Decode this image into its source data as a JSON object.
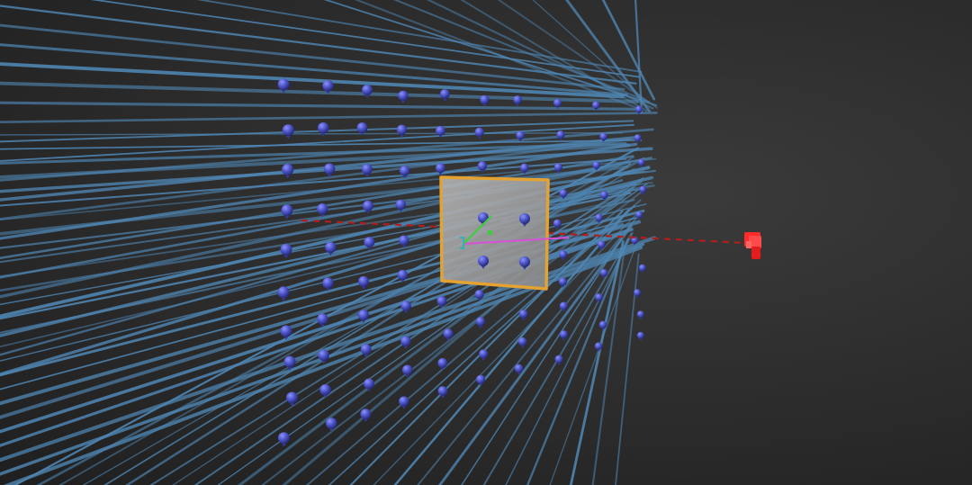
{
  "viewport": {
    "background_color": "#2b2b2b",
    "ray_color": "#4f86b3",
    "arrowhead_color": "#4b52c4",
    "plane_fill_color": "#9a9a9a",
    "plane_border_color": "#e3a232",
    "dashed_line_color": "#b01e1e",
    "emitter_color": "#ff2b2b",
    "gizmo_colors": {
      "x_axis": "#d84fd8",
      "y_axis": "#3ccf3c",
      "z_axis": "#2fb3b3"
    }
  },
  "scene": {
    "selected_object": "plane",
    "gizmo": "transform-gizmo",
    "light_source": "point-emitter",
    "vector_field": "arrow-field"
  }
}
